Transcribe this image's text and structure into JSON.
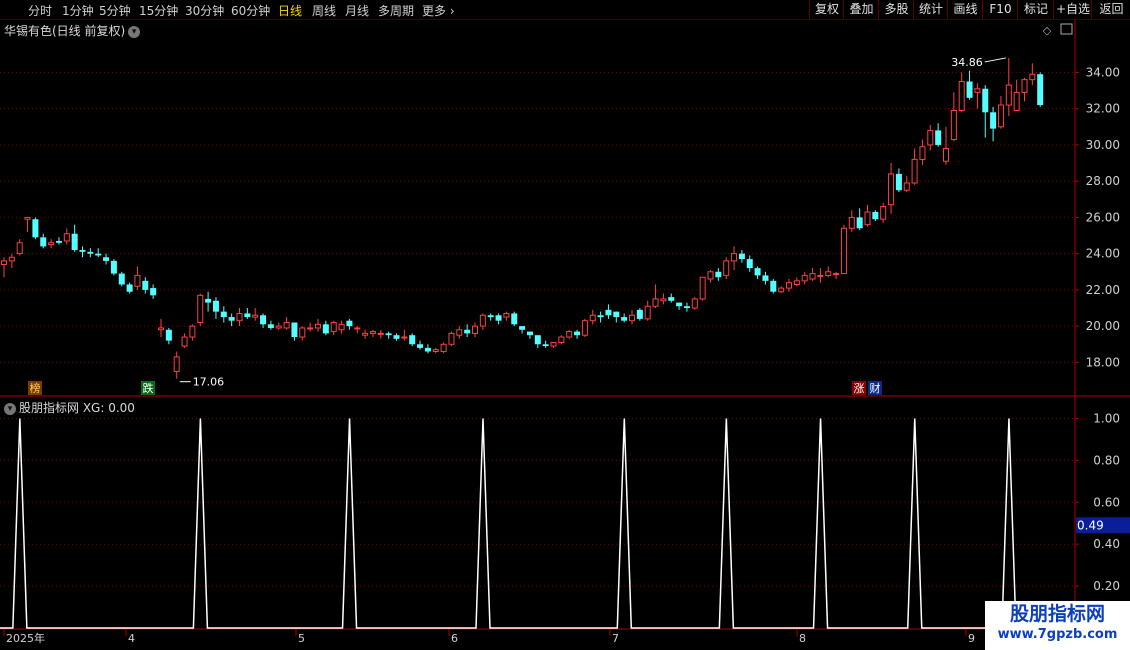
{
  "toolbar": {
    "periods": [
      "分时",
      "1分钟",
      "5分钟",
      "15分钟",
      "30分钟",
      "60分钟",
      "日线",
      "周线",
      "月线",
      "多周期"
    ],
    "active": "日线",
    "more": "更多",
    "right_buttons": [
      "复权",
      "叠加",
      "多股",
      "统计",
      "画线",
      "F10",
      "标记",
      "+自选",
      "返回"
    ]
  },
  "stock_title": "华锡有色(日线 前复权)",
  "indicator_title": "股朋指标网 XG: 0.00",
  "price_axis": {
    "labels": [
      "34.00",
      "32.00",
      "30.00",
      "28.00",
      "26.00",
      "24.00",
      "22.00",
      "20.00",
      "18.00"
    ],
    "min": 16.2,
    "max": 35.9
  },
  "indicator_axis": {
    "labels": [
      "1.00",
      "0.80",
      "0.60",
      "0.40",
      "0.20"
    ],
    "cursor_value": "0.49"
  },
  "markers": {
    "high_label": "34.86",
    "low_label": "17.06",
    "bang": "榜",
    "die": "跌",
    "zhang": "涨",
    "cai": "财"
  },
  "time_axis": [
    "2025年",
    "4",
    "5",
    "6",
    "7",
    "8",
    "9"
  ],
  "watermark": {
    "title": "股朋指标网",
    "url": "www.7gpzb.com"
  },
  "colors": {
    "up": "#ff4040",
    "down": "#54ffff",
    "grid": "#7a0000",
    "signal": "#ffffff"
  },
  "chart_data": {
    "type": "candlestick",
    "candles": [
      [
        23.4,
        23.6,
        22.7,
        23.8
      ],
      [
        23.6,
        23.8,
        23.2,
        24.0
      ],
      [
        24.0,
        24.6,
        23.9,
        24.8
      ],
      [
        25.9,
        26.0,
        25.2,
        25.9
      ],
      [
        25.9,
        24.9,
        24.8,
        26.0
      ],
      [
        24.9,
        24.4,
        24.3,
        25.1
      ],
      [
        24.5,
        24.6,
        24.3,
        24.8
      ],
      [
        24.7,
        24.6,
        24.5,
        24.9
      ],
      [
        24.7,
        25.1,
        24.5,
        25.4
      ],
      [
        25.1,
        24.2,
        24.1,
        25.6
      ],
      [
        24.2,
        24.1,
        23.8,
        24.4
      ],
      [
        24.1,
        24.0,
        23.8,
        24.3
      ],
      [
        24.0,
        23.9,
        23.8,
        24.3
      ],
      [
        23.8,
        23.6,
        23.4,
        24.0
      ],
      [
        23.6,
        22.9,
        22.8,
        23.7
      ],
      [
        22.9,
        22.3,
        22.2,
        23.0
      ],
      [
        22.3,
        21.9,
        21.8,
        22.4
      ],
      [
        22.2,
        22.8,
        22.0,
        23.3
      ],
      [
        22.5,
        22.0,
        21.8,
        22.7
      ],
      [
        22.1,
        21.7,
        21.5,
        22.3
      ],
      [
        19.8,
        19.9,
        19.4,
        20.4
      ],
      [
        19.8,
        19.2,
        19.0,
        19.9
      ],
      [
        17.5,
        18.3,
        17.1,
        18.6
      ],
      [
        18.9,
        19.4,
        18.8,
        19.6
      ],
      [
        19.4,
        20.0,
        19.2,
        20.1
      ],
      [
        20.2,
        21.7,
        20.0,
        21.8
      ],
      [
        21.5,
        21.3,
        20.8,
        21.9
      ],
      [
        21.4,
        20.8,
        20.4,
        21.6
      ],
      [
        20.8,
        20.5,
        20.2,
        21.1
      ],
      [
        20.5,
        20.3,
        20.0,
        20.7
      ],
      [
        20.3,
        20.7,
        20.0,
        21.0
      ],
      [
        20.7,
        20.5,
        20.4,
        21.0
      ],
      [
        20.5,
        20.6,
        20.3,
        21.0
      ],
      [
        20.6,
        20.1,
        19.9,
        20.7
      ],
      [
        20.1,
        19.9,
        19.8,
        20.3
      ],
      [
        19.9,
        20.0,
        19.8,
        20.2
      ],
      [
        19.9,
        20.2,
        19.8,
        20.5
      ],
      [
        20.2,
        19.4,
        19.2,
        20.2
      ],
      [
        19.4,
        19.9,
        19.2,
        20.0
      ],
      [
        19.9,
        19.9,
        19.7,
        20.2
      ],
      [
        19.9,
        20.1,
        19.7,
        20.4
      ],
      [
        20.1,
        19.6,
        19.5,
        20.3
      ],
      [
        19.7,
        20.2,
        19.5,
        20.3
      ],
      [
        19.8,
        20.1,
        19.6,
        20.3
      ],
      [
        20.3,
        20.0,
        19.8,
        20.4
      ],
      [
        19.9,
        19.9,
        19.6,
        20.0
      ],
      [
        19.5,
        19.6,
        19.3,
        19.8
      ],
      [
        19.6,
        19.7,
        19.4,
        19.8
      ],
      [
        19.6,
        19.6,
        19.3,
        19.8
      ],
      [
        19.6,
        19.5,
        19.3,
        19.7
      ],
      [
        19.5,
        19.3,
        19.2,
        19.6
      ],
      [
        19.4,
        19.4,
        19.2,
        19.8
      ],
      [
        19.5,
        19.0,
        18.9,
        19.6
      ],
      [
        19.0,
        18.8,
        18.7,
        19.2
      ],
      [
        18.8,
        18.6,
        18.5,
        19.0
      ],
      [
        18.6,
        18.7,
        18.5,
        18.8
      ],
      [
        18.6,
        19.0,
        18.5,
        19.1
      ],
      [
        19.0,
        19.6,
        18.9,
        19.7
      ],
      [
        19.5,
        19.8,
        19.3,
        20.0
      ],
      [
        19.8,
        19.6,
        19.4,
        20.1
      ],
      [
        19.6,
        20.0,
        19.4,
        20.2
      ],
      [
        20.0,
        20.6,
        19.8,
        20.7
      ],
      [
        20.6,
        20.5,
        20.3,
        20.7
      ],
      [
        20.6,
        20.3,
        20.1,
        20.7
      ],
      [
        20.5,
        20.7,
        20.3,
        20.8
      ],
      [
        20.7,
        20.1,
        20.0,
        20.8
      ],
      [
        20.0,
        19.8,
        19.6,
        20.0
      ],
      [
        19.7,
        19.5,
        19.3,
        19.7
      ],
      [
        19.5,
        19.0,
        18.8,
        19.5
      ],
      [
        19.0,
        18.9,
        18.8,
        19.2
      ],
      [
        18.9,
        19.1,
        18.8,
        19.1
      ],
      [
        19.1,
        19.4,
        19.0,
        19.5
      ],
      [
        19.4,
        19.7,
        19.3,
        19.8
      ],
      [
        19.7,
        19.5,
        19.3,
        19.8
      ],
      [
        19.5,
        20.3,
        19.4,
        20.4
      ],
      [
        20.3,
        20.6,
        20.1,
        20.9
      ],
      [
        20.6,
        20.5,
        20.2,
        20.8
      ],
      [
        20.9,
        20.6,
        20.4,
        21.2
      ],
      [
        20.8,
        20.5,
        20.2,
        20.8
      ],
      [
        20.5,
        20.3,
        20.2,
        20.7
      ],
      [
        20.3,
        20.6,
        20.1,
        20.9
      ],
      [
        20.9,
        20.4,
        20.3,
        21.0
      ],
      [
        20.4,
        21.1,
        20.3,
        21.4
      ],
      [
        21.1,
        21.5,
        21.0,
        22.3
      ],
      [
        21.4,
        21.5,
        21.2,
        21.8
      ],
      [
        21.6,
        21.4,
        21.3,
        21.8
      ],
      [
        21.3,
        21.1,
        20.9,
        21.3
      ],
      [
        21.1,
        21.0,
        20.8,
        21.3
      ],
      [
        21.0,
        21.5,
        20.9,
        21.6
      ],
      [
        21.5,
        22.7,
        21.4,
        22.7
      ],
      [
        22.6,
        23.0,
        22.4,
        23.1
      ],
      [
        23.0,
        22.7,
        22.5,
        23.2
      ],
      [
        22.8,
        23.6,
        22.6,
        23.8
      ],
      [
        23.6,
        24.0,
        23.1,
        24.4
      ],
      [
        24.0,
        23.7,
        23.5,
        24.2
      ],
      [
        23.7,
        23.2,
        23.0,
        23.9
      ],
      [
        23.2,
        22.8,
        22.6,
        23.3
      ],
      [
        22.8,
        22.5,
        22.3,
        23.0
      ],
      [
        22.5,
        21.9,
        21.8,
        22.6
      ],
      [
        21.9,
        22.1,
        21.8,
        22.2
      ],
      [
        22.1,
        22.4,
        21.9,
        22.6
      ],
      [
        22.3,
        22.5,
        22.2,
        22.7
      ],
      [
        22.5,
        22.8,
        22.3,
        23.0
      ],
      [
        22.6,
        22.9,
        22.5,
        23.2
      ],
      [
        22.8,
        22.8,
        22.4,
        23.2
      ],
      [
        22.8,
        23.0,
        22.7,
        23.3
      ],
      [
        22.9,
        22.9,
        22.6,
        23.0
      ],
      [
        22.9,
        25.4,
        22.9,
        25.6
      ],
      [
        25.4,
        26.0,
        25.2,
        26.4
      ],
      [
        26.0,
        25.4,
        25.3,
        26.5
      ],
      [
        25.6,
        26.3,
        25.5,
        26.7
      ],
      [
        26.3,
        25.9,
        25.8,
        26.4
      ],
      [
        25.9,
        26.6,
        25.7,
        26.8
      ],
      [
        26.7,
        28.4,
        26.2,
        29.0
      ],
      [
        28.4,
        27.5,
        27.4,
        28.7
      ],
      [
        27.5,
        27.9,
        27.4,
        28.3
      ],
      [
        27.9,
        29.2,
        27.8,
        29.8
      ],
      [
        29.2,
        29.9,
        28.9,
        30.3
      ],
      [
        30.0,
        30.8,
        29.7,
        31.1
      ],
      [
        30.8,
        30.0,
        29.9,
        31.2
      ],
      [
        29.1,
        29.8,
        28.9,
        31.0
      ],
      [
        30.3,
        31.9,
        30.2,
        32.9
      ],
      [
        31.9,
        33.5,
        31.8,
        34.0
      ],
      [
        33.5,
        32.6,
        32.5,
        34.1
      ],
      [
        32.9,
        33.1,
        32.0,
        33.4
      ],
      [
        33.1,
        31.8,
        30.4,
        33.3
      ],
      [
        31.8,
        30.9,
        30.2,
        32.1
      ],
      [
        31.0,
        32.2,
        30.9,
        32.7
      ],
      [
        32.2,
        33.3,
        31.6,
        34.8
      ],
      [
        31.9,
        32.9,
        31.9,
        33.6
      ],
      [
        32.9,
        33.6,
        32.4,
        33.7
      ],
      [
        33.6,
        33.9,
        33.3,
        34.5
      ],
      [
        33.9,
        32.2,
        32.1,
        34.0
      ]
    ],
    "high": 34.86,
    "low": 17.06,
    "xg_signal_candle_index": [
      1,
      24,
      43,
      60,
      78,
      91,
      103,
      115,
      127
    ],
    "xg_range": [
      0,
      1.05
    ]
  }
}
